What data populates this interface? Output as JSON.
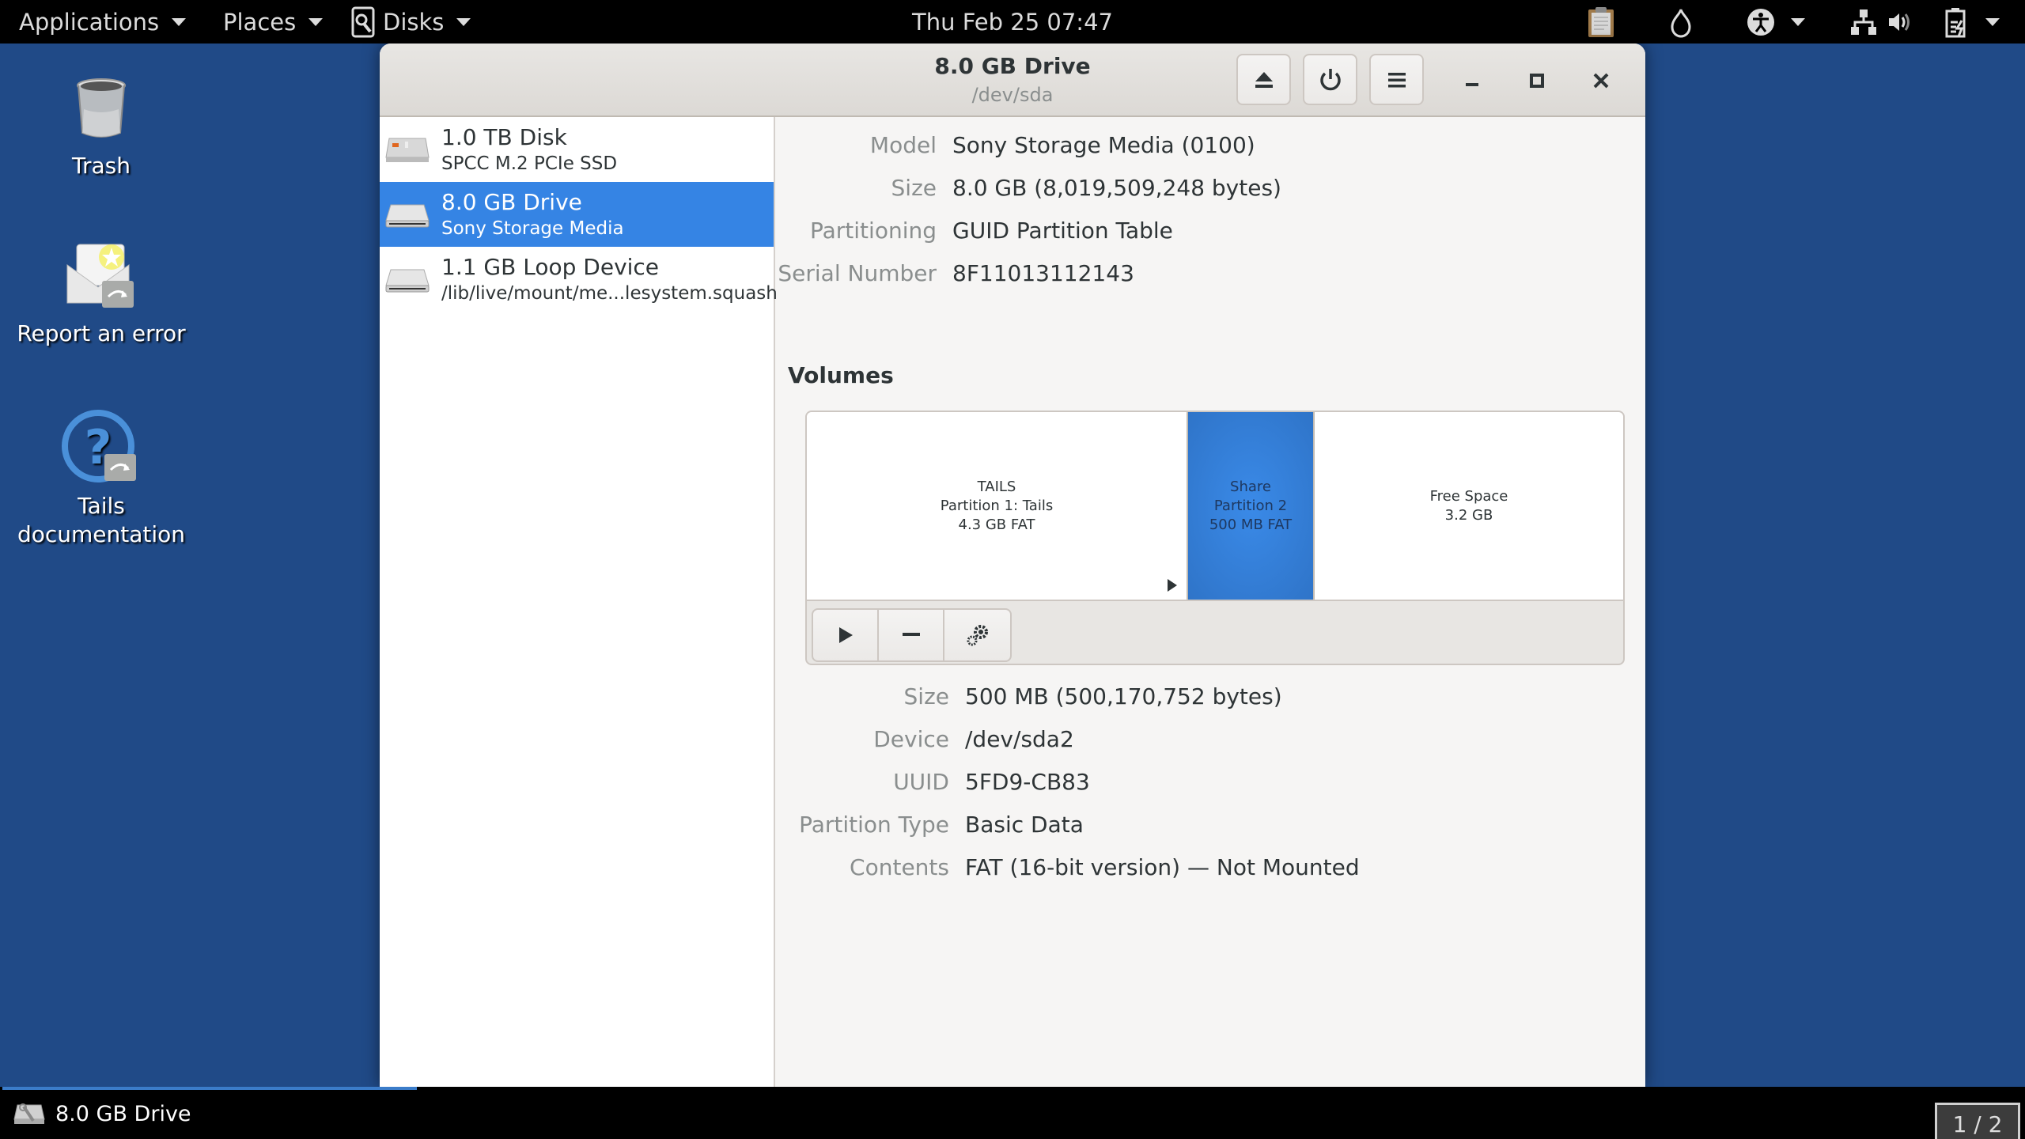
{
  "topbar": {
    "applications_label": "Applications",
    "places_label": "Places",
    "app_menu_label": "Disks",
    "clock": "Thu Feb 25  07:47",
    "status_icons": [
      "clipboard-icon",
      "tor-onion-icon",
      "accessibility-icon",
      "network-icon",
      "volume-icon",
      "battery-icon"
    ]
  },
  "desktop": {
    "icons": [
      {
        "label": "Trash",
        "icon": "trash-icon"
      },
      {
        "label": "Report an error",
        "icon": "report-error-icon"
      },
      {
        "label": "Tails documentation",
        "icon": "help-icon"
      }
    ]
  },
  "window": {
    "title": "8.0 GB Drive",
    "subtitle": "/dev/sda",
    "header_buttons": [
      "eject",
      "power-off",
      "menu"
    ],
    "controls": [
      "minimize",
      "maximize",
      "close"
    ]
  },
  "sidebar": {
    "drives": [
      {
        "name": "1.0 TB Disk",
        "subtitle": "SPCC M.2 PCIe SSD",
        "selected": false
      },
      {
        "name": "8.0 GB Drive",
        "subtitle": "Sony Storage Media",
        "selected": true
      },
      {
        "name": "1.1 GB Loop Device",
        "subtitle": "/lib/live/mount/me...lesystem.squashfs",
        "selected": false
      }
    ]
  },
  "drive_props": [
    {
      "label": "Model",
      "value": "Sony Storage Media (0100)"
    },
    {
      "label": "Size",
      "value": "8.0 GB (8,019,509,248 bytes)"
    },
    {
      "label": "Partitioning",
      "value": "GUID Partition Table"
    },
    {
      "label": "Serial Number",
      "value": "8F11013112143"
    }
  ],
  "volumes": {
    "heading": "Volumes",
    "segments": [
      {
        "lines": [
          "TAILS",
          "Partition 1: Tails",
          "4.3 GB FAT"
        ],
        "selected": false,
        "has_expander": true
      },
      {
        "lines": [
          "Share",
          "Partition 2",
          "500 MB FAT"
        ],
        "selected": true,
        "has_expander": false
      },
      {
        "lines": [
          "Free Space",
          "3.2 GB"
        ],
        "selected": false,
        "has_expander": false
      }
    ],
    "toolbar": [
      "mount",
      "delete-partition",
      "additional-options"
    ]
  },
  "volume_props": [
    {
      "label": "Size",
      "value": "500 MB (500,170,752 bytes)"
    },
    {
      "label": "Device",
      "value": "/dev/sda2"
    },
    {
      "label": "UUID",
      "value": "5FD9-CB83"
    },
    {
      "label": "Partition Type",
      "value": "Basic Data"
    },
    {
      "label": "Contents",
      "value": "FAT (16-bit version) — Not Mounted"
    }
  ],
  "taskbar": {
    "active_window": "8.0 GB Drive",
    "workspace": "1 / 2"
  },
  "colors": {
    "desktop_bg": "#204a87",
    "selection": "#3584e4",
    "panel_bg": "#000000"
  }
}
